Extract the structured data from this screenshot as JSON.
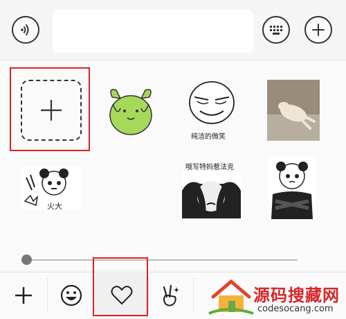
{
  "top_bar": {
    "voice_icon": "voice-icon",
    "input_value": "",
    "keyboard_icon": "keyboard-icon",
    "plus_icon": "plus-icon"
  },
  "stickers": [
    {
      "name": "add-sticker-tile",
      "caption": ""
    },
    {
      "name": "green-cartoon-sticker",
      "caption": ""
    },
    {
      "name": "smug-face-sticker",
      "caption": "纯洁的微笑"
    },
    {
      "name": "dog-photo-sticker",
      "caption": ""
    },
    {
      "name": "panda-fire-sticker",
      "caption": "火大"
    },
    {
      "name": "panda-cover-face-sticker",
      "caption": "哦写特妈惹法克"
    },
    {
      "name": "panda-crossed-arms-sticker",
      "caption": ""
    }
  ],
  "slider": {
    "position": 0
  },
  "bottom_tabs": [
    {
      "name": "add-tab",
      "icon": "plus-icon"
    },
    {
      "name": "emoji-tab",
      "icon": "smiley-icon"
    },
    {
      "name": "favorites-tab",
      "icon": "heart-icon",
      "selected": true
    },
    {
      "name": "gesture-tab",
      "icon": "victory-hand-icon"
    }
  ],
  "watermark": {
    "title": "源码搜藏网",
    "url": "codesocang.com"
  },
  "colors": {
    "highlight": "#e02020",
    "sticker_green": "#a6d85a"
  }
}
